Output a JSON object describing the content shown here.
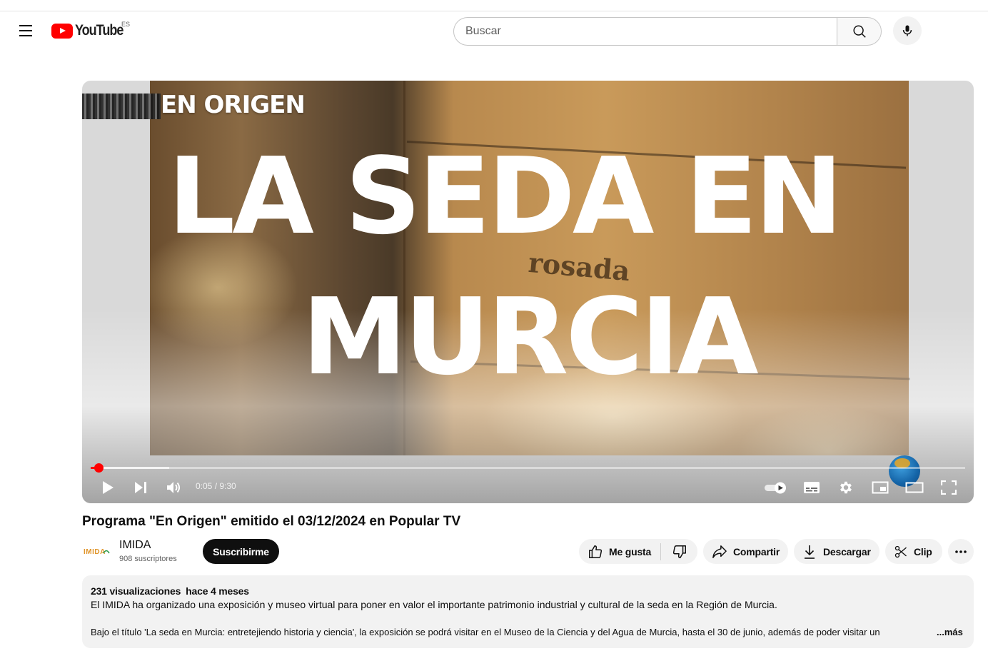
{
  "masthead": {
    "logo_text": "YouTube",
    "region_code": "ES",
    "search_placeholder": "Buscar"
  },
  "player": {
    "overlay_origin": "EN ORIGEN",
    "overlay_title_line1": "LA SEDA EN",
    "overlay_title_line2": "MURCIA",
    "jar_text": "rosada",
    "current_time": "0:05",
    "time_separator": " / ",
    "duration": "9:30",
    "progress_played_fraction": 0.009,
    "progress_buffered_fraction": 0.09
  },
  "video": {
    "title": "Programa \"En Origen\" emitido el 03/12/2024 en Popular TV"
  },
  "channel": {
    "avatar_text": "IMIDA",
    "name": "IMIDA",
    "subscribers": "908 suscriptores",
    "subscribe_label": "Suscribirme"
  },
  "actions": {
    "like_label": "Me gusta",
    "share_label": "Compartir",
    "download_label": "Descargar",
    "clip_label": "Clip"
  },
  "description": {
    "views": "231 visualizaciones",
    "date": "hace 4 meses",
    "line1": "El IMIDA ha organizado una exposición y museo virtual para poner en valor el importante patrimonio industrial y cultural de la seda en la Región de Murcia.",
    "line2": "Bajo el título 'La seda en Murcia: entretejiendo historia y ciencia', la exposición se podrá visitar en el Museo de la Ciencia y del Agua de Murcia, hasta el 30 de junio, además de poder visitar un",
    "more_label": "...más"
  },
  "colors": {
    "brand_red": "#ff0000",
    "subscribe_bg": "#0f0f0f",
    "pill_bg": "#f2f2f2"
  },
  "icons": [
    "menu-icon",
    "search-icon",
    "microphone-icon",
    "play-icon",
    "next-icon",
    "volume-icon",
    "autoplay-toggle-icon",
    "subtitles-icon",
    "settings-icon",
    "miniplayer-icon",
    "theater-icon",
    "fullscreen-icon",
    "thumbs-up-icon",
    "thumbs-down-icon",
    "share-icon",
    "download-icon",
    "scissors-icon",
    "more-icon"
  ]
}
